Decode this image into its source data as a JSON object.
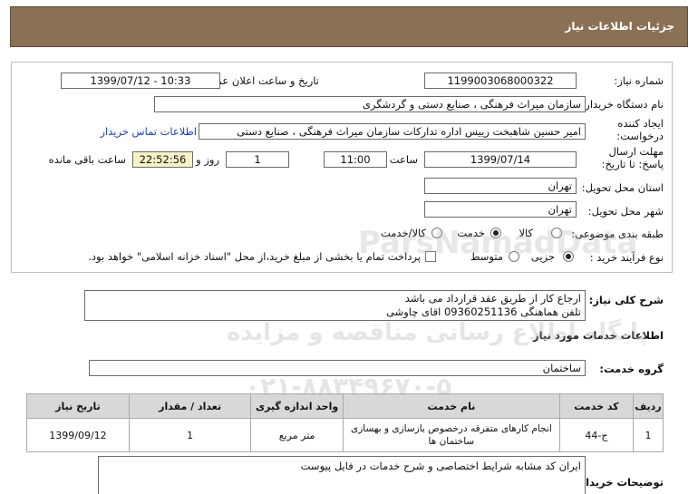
{
  "header": {
    "title": "جزئیات اطلاعات نیاز"
  },
  "fields": {
    "need_number_label": "شماره نیاز:",
    "need_number": "1199003068000322",
    "announce_label": "تاریخ و ساعت اعلان عمومی:",
    "announce_value": "1399/07/12 - 10:33",
    "buyer_org_label": "نام دستگاه خریدار:",
    "buyer_org": "سازمان میراث فرهنگی ، صنایع دستی و گردشگری",
    "creator_label": "ایجاد کننده درخواست:",
    "creator": "امیر حسین شاهبخت رییس اداره تداركات سازمان میراث فرهنگی ، صنایع دستی",
    "contact_link": "اطلاعات تماس خریدار",
    "deadline_label": "مهلت ارسال پاسخ: تا تاریخ:",
    "deadline_date": "1399/07/14",
    "time_label": "ساعت",
    "deadline_time": "11:00",
    "days_value": "1",
    "days_label": "روز و",
    "remaining_time": "22:52:56",
    "remaining_label": "ساعت باقی مانده",
    "province_label": "استان محل تحویل:",
    "province": "تهران",
    "city_label": "شهر محل تحویل:",
    "city": "تهران",
    "category_label": "طبقه بندی موضوعی:",
    "category_options": [
      "کالا",
      "خدمت",
      "کالا/خدمت"
    ],
    "category_selected": "خدمت",
    "process_label": "نوع فرآیند خرید :",
    "process_options": [
      "جزیی",
      "متوسط"
    ],
    "process_selected": "جزیی",
    "payment_note": "پرداخت تمام یا بخشی از مبلغ خرید،از محل \"اسناد خزانه اسلامی\" خواهد بود."
  },
  "summary": {
    "label": "شرح کلی نیاز:",
    "line1": "ارجاع کار از طریق عقد قرارداد می باشد",
    "line2": "تلفن هماهنگی 09360251136 اقای چاوشی"
  },
  "services": {
    "title": "اطلاعات خدمات مورد نیاز",
    "group_label": "گروه خدمت:",
    "group_value": "ساختمان",
    "columns": [
      "ردیف",
      "کد خدمت",
      "نام خدمت",
      "واحد اندازه گیری",
      "تعداد / مقدار",
      "تاریخ نیاز"
    ],
    "rows": [
      {
        "index": "1",
        "code": "ج-44",
        "name": "انجام کارهای متفرقه درخصوص بازسازی و بهسازی ساختمان ها",
        "unit": "متر مربع",
        "qty": "1",
        "date": "1399/09/12"
      }
    ]
  },
  "buyer_notes": {
    "label": "توضیحات خریدار:",
    "text": "ایران کد مشابه شرایط اختصاصی و شرح خدمات در فایل پیوست"
  },
  "watermark": {
    "brand": "ParsNamadData",
    "line1": "پایگاه اطلاع رسانی مناقصه و مزایده",
    "line2": "۰۲۱-۸۸۳۴۹۶۷۰-۵"
  }
}
